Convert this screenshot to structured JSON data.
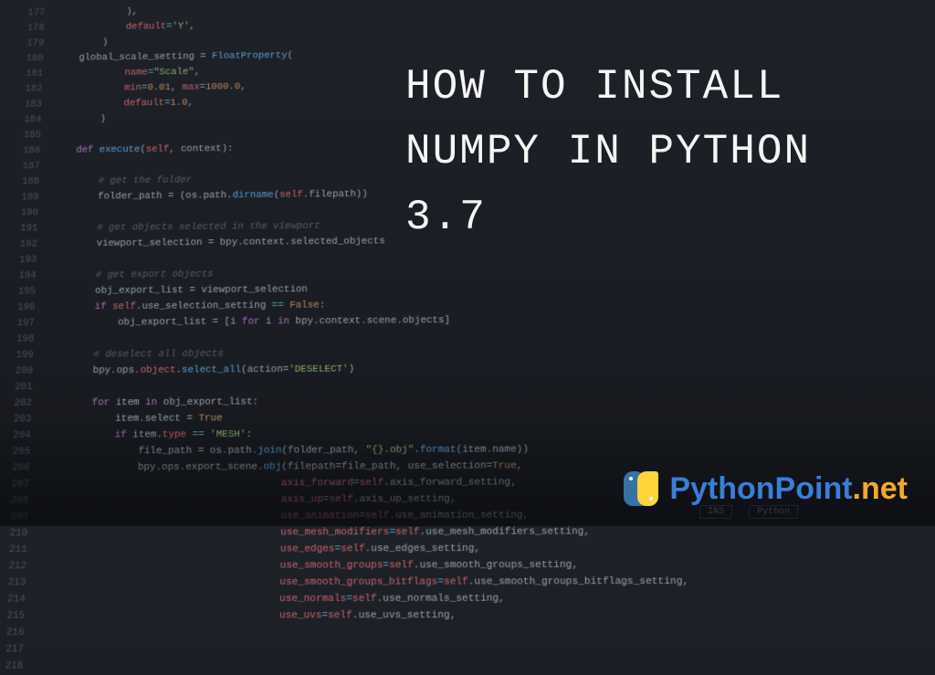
{
  "title": "HOW TO INSTALL NUMPY IN PYTHON 3.7",
  "brand": {
    "name1": "PythonPoint",
    "name2": ".net"
  },
  "line_start": 177,
  "line_end": 218,
  "statusbar": {
    "mode": "INS",
    "lang": "Python"
  },
  "code_lines": [
    {
      "indent": 12,
      "tokens": [
        {
          "t": ")",
          "c": ""
        },
        {
          "t": ",",
          "c": ""
        }
      ]
    },
    {
      "indent": 12,
      "tokens": [
        {
          "t": "default",
          "c": "attr"
        },
        {
          "t": "=",
          "c": "op"
        },
        {
          "t": "'Y'",
          "c": "str"
        },
        {
          "t": ",",
          "c": ""
        }
      ]
    },
    {
      "indent": 8,
      "tokens": [
        {
          "t": ")",
          "c": ""
        }
      ]
    },
    {
      "indent": 4,
      "tokens": [
        {
          "t": "global_scale_setting",
          "c": ""
        },
        {
          "t": " = ",
          "c": ""
        },
        {
          "t": "FloatProperty",
          "c": "fn"
        },
        {
          "t": "(",
          "c": ""
        }
      ]
    },
    {
      "indent": 12,
      "tokens": [
        {
          "t": "name",
          "c": "attr"
        },
        {
          "t": "=",
          "c": "op"
        },
        {
          "t": "\"Scale\"",
          "c": "str"
        },
        {
          "t": ",",
          "c": ""
        }
      ]
    },
    {
      "indent": 12,
      "tokens": [
        {
          "t": "min",
          "c": "attr"
        },
        {
          "t": "=",
          "c": "op"
        },
        {
          "t": "0.01",
          "c": "num"
        },
        {
          "t": ", ",
          "c": ""
        },
        {
          "t": "max",
          "c": "attr"
        },
        {
          "t": "=",
          "c": "op"
        },
        {
          "t": "1000.0",
          "c": "num"
        },
        {
          "t": ",",
          "c": ""
        }
      ]
    },
    {
      "indent": 12,
      "tokens": [
        {
          "t": "default",
          "c": "attr"
        },
        {
          "t": "=",
          "c": "op"
        },
        {
          "t": "1.0",
          "c": "num"
        },
        {
          "t": ",",
          "c": ""
        }
      ]
    },
    {
      "indent": 8,
      "tokens": [
        {
          "t": ")",
          "c": ""
        }
      ]
    },
    {
      "indent": 0,
      "tokens": []
    },
    {
      "indent": 4,
      "tokens": [
        {
          "t": "def ",
          "c": "kw"
        },
        {
          "t": "execute",
          "c": "def"
        },
        {
          "t": "(",
          "c": ""
        },
        {
          "t": "self",
          "c": "self"
        },
        {
          "t": ", context):",
          "c": ""
        }
      ]
    },
    {
      "indent": 0,
      "tokens": []
    },
    {
      "indent": 8,
      "tokens": [
        {
          "t": "# get the folder",
          "c": "com"
        }
      ]
    },
    {
      "indent": 8,
      "tokens": [
        {
          "t": "folder_path",
          "c": ""
        },
        {
          "t": " = (",
          "c": ""
        },
        {
          "t": "os",
          "c": ""
        },
        {
          "t": ".",
          "c": ""
        },
        {
          "t": "path",
          "c": ""
        },
        {
          "t": ".",
          "c": ""
        },
        {
          "t": "dirname",
          "c": "fn"
        },
        {
          "t": "(",
          "c": ""
        },
        {
          "t": "self",
          "c": "self"
        },
        {
          "t": ".filepath))",
          "c": ""
        }
      ]
    },
    {
      "indent": 0,
      "tokens": []
    },
    {
      "indent": 8,
      "tokens": [
        {
          "t": "# get objects selected in the viewport",
          "c": "com"
        }
      ]
    },
    {
      "indent": 8,
      "tokens": [
        {
          "t": "viewport_selection",
          "c": ""
        },
        {
          "t": " = bpy.context.selected_objects",
          "c": ""
        }
      ]
    },
    {
      "indent": 0,
      "tokens": []
    },
    {
      "indent": 8,
      "tokens": [
        {
          "t": "# get export objects",
          "c": "com"
        }
      ]
    },
    {
      "indent": 8,
      "tokens": [
        {
          "t": "obj_export_list",
          "c": ""
        },
        {
          "t": " = viewport_selection",
          "c": ""
        }
      ]
    },
    {
      "indent": 8,
      "tokens": [
        {
          "t": "if ",
          "c": "kw"
        },
        {
          "t": "self",
          "c": "self"
        },
        {
          "t": ".use_selection_setting ",
          "c": ""
        },
        {
          "t": "== ",
          "c": "op"
        },
        {
          "t": "False",
          "c": "bool"
        },
        {
          "t": ":",
          "c": ""
        }
      ]
    },
    {
      "indent": 12,
      "tokens": [
        {
          "t": "obj_export_list",
          "c": ""
        },
        {
          "t": " = [i ",
          "c": ""
        },
        {
          "t": "for ",
          "c": "kw"
        },
        {
          "t": "i ",
          "c": ""
        },
        {
          "t": "in ",
          "c": "kw"
        },
        {
          "t": "bpy.context.scene.objects]",
          "c": ""
        }
      ]
    },
    {
      "indent": 0,
      "tokens": []
    },
    {
      "indent": 8,
      "tokens": [
        {
          "t": "# deselect all objects",
          "c": "com"
        }
      ]
    },
    {
      "indent": 8,
      "tokens": [
        {
          "t": "bpy.ops.",
          "c": ""
        },
        {
          "t": "object",
          "c": "attr"
        },
        {
          "t": ".",
          "c": ""
        },
        {
          "t": "select_all",
          "c": "fn"
        },
        {
          "t": "(action=",
          "c": ""
        },
        {
          "t": "'DESELECT'",
          "c": "str"
        },
        {
          "t": ")",
          "c": ""
        }
      ]
    },
    {
      "indent": 0,
      "tokens": []
    },
    {
      "indent": 8,
      "tokens": [
        {
          "t": "for ",
          "c": "kw"
        },
        {
          "t": "item ",
          "c": ""
        },
        {
          "t": "in ",
          "c": "kw"
        },
        {
          "t": "obj_export_list:",
          "c": ""
        }
      ]
    },
    {
      "indent": 12,
      "tokens": [
        {
          "t": "item.select",
          "c": ""
        },
        {
          "t": " = ",
          "c": ""
        },
        {
          "t": "True",
          "c": "bool"
        }
      ]
    },
    {
      "indent": 12,
      "tokens": [
        {
          "t": "if ",
          "c": "kw"
        },
        {
          "t": "item.",
          "c": ""
        },
        {
          "t": "type",
          "c": "attr"
        },
        {
          "t": " == ",
          "c": "op"
        },
        {
          "t": "'MESH'",
          "c": "str"
        },
        {
          "t": ":",
          "c": ""
        }
      ]
    },
    {
      "indent": 16,
      "tokens": [
        {
          "t": "file_path",
          "c": ""
        },
        {
          "t": " = os.path.",
          "c": ""
        },
        {
          "t": "join",
          "c": "fn"
        },
        {
          "t": "(folder_path, ",
          "c": ""
        },
        {
          "t": "\"{}.obj\"",
          "c": "str"
        },
        {
          "t": ".",
          "c": ""
        },
        {
          "t": "format",
          "c": "fn"
        },
        {
          "t": "(item.name))",
          "c": ""
        }
      ]
    },
    {
      "indent": 16,
      "tokens": [
        {
          "t": "bpy.ops.export_scene.",
          "c": ""
        },
        {
          "t": "obj",
          "c": "fn"
        },
        {
          "t": "(filepath=file_path, use_selection=",
          "c": ""
        },
        {
          "t": "True",
          "c": "bool"
        },
        {
          "t": ",",
          "c": ""
        }
      ]
    },
    {
      "indent": 40,
      "tokens": [
        {
          "t": "axis_forward",
          "c": "attr"
        },
        {
          "t": "=",
          "c": "op"
        },
        {
          "t": "self",
          "c": "self"
        },
        {
          "t": ".axis_forward_setting,",
          "c": ""
        }
      ]
    },
    {
      "indent": 40,
      "tokens": [
        {
          "t": "axis_up",
          "c": "attr"
        },
        {
          "t": "=",
          "c": "op"
        },
        {
          "t": "self",
          "c": "self"
        },
        {
          "t": ".axis_up_setting,",
          "c": ""
        }
      ]
    },
    {
      "indent": 40,
      "tokens": [
        {
          "t": "use_animation",
          "c": "attr"
        },
        {
          "t": "=",
          "c": "op"
        },
        {
          "t": "self",
          "c": "self"
        },
        {
          "t": ".use_animation_setting,",
          "c": ""
        }
      ]
    },
    {
      "indent": 40,
      "tokens": [
        {
          "t": "use_mesh_modifiers",
          "c": "attr"
        },
        {
          "t": "=",
          "c": "op"
        },
        {
          "t": "self",
          "c": "self"
        },
        {
          "t": ".use_mesh_modifiers_setting,",
          "c": ""
        }
      ]
    },
    {
      "indent": 40,
      "tokens": [
        {
          "t": "use_edges",
          "c": "attr"
        },
        {
          "t": "=",
          "c": "op"
        },
        {
          "t": "self",
          "c": "self"
        },
        {
          "t": ".use_edges_setting,",
          "c": ""
        }
      ]
    },
    {
      "indent": 40,
      "tokens": [
        {
          "t": "use_smooth_groups",
          "c": "attr"
        },
        {
          "t": "=",
          "c": "op"
        },
        {
          "t": "self",
          "c": "self"
        },
        {
          "t": ".use_smooth_groups_setting,",
          "c": ""
        }
      ]
    },
    {
      "indent": 40,
      "tokens": [
        {
          "t": "use_smooth_groups_bitflags",
          "c": "attr"
        },
        {
          "t": "=",
          "c": "op"
        },
        {
          "t": "self",
          "c": "self"
        },
        {
          "t": ".use_smooth_groups_bitflags_setting,",
          "c": ""
        }
      ]
    },
    {
      "indent": 40,
      "tokens": [
        {
          "t": "use_normals",
          "c": "attr"
        },
        {
          "t": "=",
          "c": "op"
        },
        {
          "t": "self",
          "c": "self"
        },
        {
          "t": ".use_normals_setting,",
          "c": ""
        }
      ]
    },
    {
      "indent": 40,
      "tokens": [
        {
          "t": "use_uvs",
          "c": "attr"
        },
        {
          "t": "=",
          "c": "op"
        },
        {
          "t": "self",
          "c": "self"
        },
        {
          "t": ".use_uvs_setting,",
          "c": ""
        }
      ]
    }
  ]
}
